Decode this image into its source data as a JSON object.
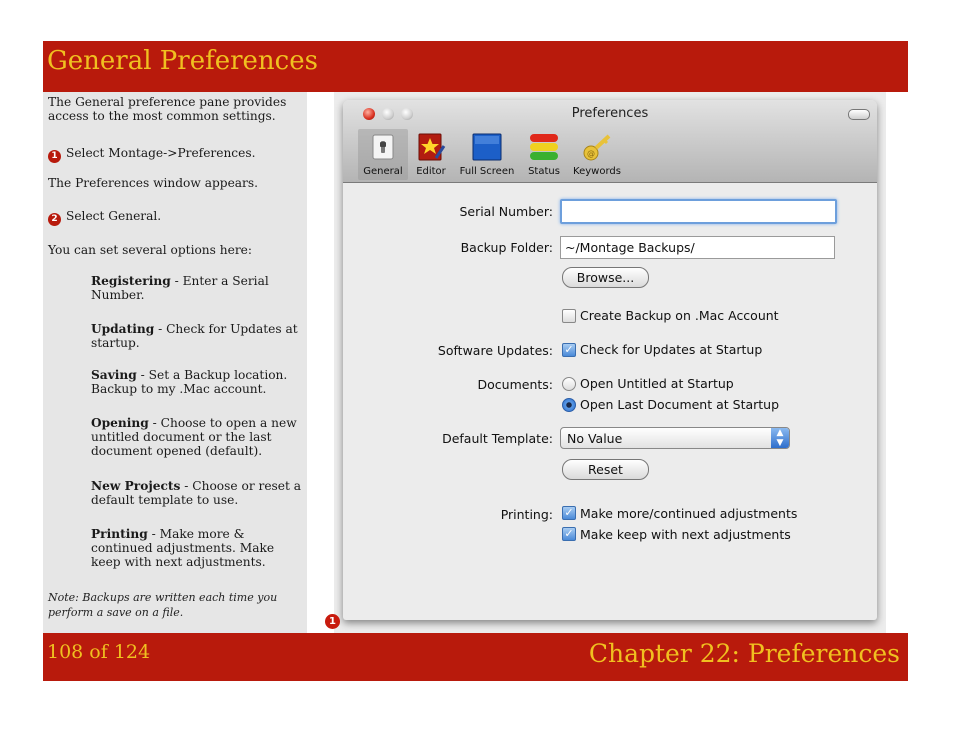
{
  "header": {
    "title": "General Preferences"
  },
  "footer": {
    "page": "108 of 124",
    "chapter": "Chapter 22: Preferences"
  },
  "sidebar": {
    "intro": "The General preference pane provides access to the most common settings.",
    "step1_num": "1",
    "step1": "Select Montage->Preferences.",
    "appears": "The Preferences window appears.",
    "step2_num": "2",
    "step2": "Select General.",
    "options_intro": "You can set several options here:",
    "options": [
      {
        "title": "Registering",
        "text": " - Enter a Serial Number."
      },
      {
        "title": "Updating",
        "text": " - Check for Updates at startup."
      },
      {
        "title": "Saving",
        "text": " - Set a Backup location. Backup to my .Mac account."
      },
      {
        "title": "Opening",
        "text": " - Choose to open a new untitled document or the last document opened (default)."
      },
      {
        "title": "New Projects",
        "text": " - Choose or reset a default template to use."
      },
      {
        "title": "Printing",
        "text": " - Make more & continued adjustments. Make keep with next adjustments."
      }
    ],
    "note": "Note: Backups are written each time you perform a save on a file."
  },
  "callout": "1",
  "window": {
    "title": "Preferences",
    "toolbar": [
      {
        "label": "General",
        "icon": "switch-icon"
      },
      {
        "label": "Editor",
        "icon": "star-book-icon"
      },
      {
        "label": "Full Screen",
        "icon": "blue-screen-icon"
      },
      {
        "label": "Status",
        "icon": "traffic-light-icon"
      },
      {
        "label": "Keywords",
        "icon": "key-icon"
      }
    ],
    "form": {
      "serial_label": "Serial Number:",
      "serial_value": "",
      "backup_label": "Backup Folder:",
      "backup_value": "~/Montage Backups/",
      "browse_button": "Browse...",
      "mac_backup": "Create Backup on .Mac Account",
      "updates_label": "Software Updates:",
      "updates_check": "Check for Updates at Startup",
      "documents_label": "Documents:",
      "doc_option1": "Open Untitled at Startup",
      "doc_option2": "Open Last Document at Startup",
      "template_label": "Default Template:",
      "template_value": "No Value",
      "reset_button": "Reset",
      "printing_label": "Printing:",
      "print_option1": "Make more/continued adjustments",
      "print_option2": "Make keep with next adjustments"
    }
  },
  "colors": {
    "band": "#b81a0c",
    "band_text": "#f0c020",
    "sidebar": "#e6e6e6"
  }
}
